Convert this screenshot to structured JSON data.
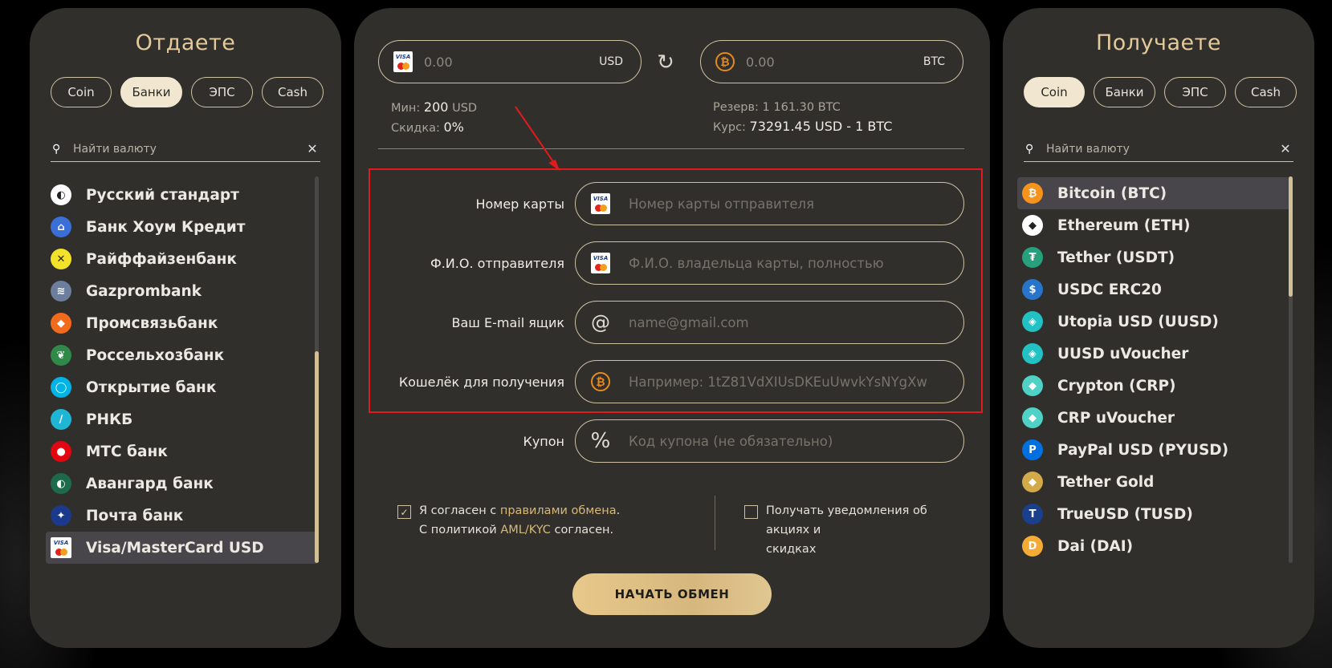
{
  "left": {
    "title": "Отдаете",
    "tabs": [
      "Coin",
      "Банки",
      "ЭПС",
      "Cash"
    ],
    "active_tab": "Банки",
    "search_placeholder": "Найти валюту",
    "items": [
      {
        "label": "Русский стандарт",
        "icon": "russkiy-standart-icon",
        "color": "#ffffff"
      },
      {
        "label": "Банк Хоум Кредит",
        "icon": "home-credit-icon",
        "color": "#3a6fd8"
      },
      {
        "label": "Райффайзенбанк",
        "icon": "raiffeisen-icon",
        "color": "#f4e22a"
      },
      {
        "label": "Gazprombank",
        "icon": "gazprombank-icon",
        "color": "#6d7d9c"
      },
      {
        "label": "Промсвязьбанк",
        "icon": "psb-icon",
        "color": "#f26b1d"
      },
      {
        "label": "Россельхозбанк",
        "icon": "rshb-icon",
        "color": "#2f8a4a"
      },
      {
        "label": "Открытие банк",
        "icon": "otkritie-icon",
        "color": "#00b4e6"
      },
      {
        "label": "РНКБ",
        "icon": "rnkb-icon",
        "color": "#1fb6d6"
      },
      {
        "label": "МТС банк",
        "icon": "mts-icon",
        "color": "#e30611"
      },
      {
        "label": "Авангард банк",
        "icon": "avangard-icon",
        "color": "#1d6b4a"
      },
      {
        "label": "Почта банк",
        "icon": "pochta-icon",
        "color": "#1b3a8c"
      },
      {
        "label": "Visa/MasterCard USD",
        "icon": "visa-mastercard-icon",
        "color": "#ffffff",
        "selected": true
      }
    ]
  },
  "right": {
    "title": "Получаете",
    "tabs": [
      "Coin",
      "Банки",
      "ЭПС",
      "Cash"
    ],
    "active_tab": "Coin",
    "search_placeholder": "Найти валюту",
    "items": [
      {
        "label": "Bitcoin (BTC)",
        "icon": "bitcoin-icon",
        "color": "#f7931a",
        "selected": true
      },
      {
        "label": "Ethereum (ETH)",
        "icon": "ethereum-icon",
        "color": "#ffffff"
      },
      {
        "label": "Tether (USDT)",
        "icon": "tether-icon",
        "color": "#26a17b"
      },
      {
        "label": "USDC ERC20",
        "icon": "usdc-icon",
        "color": "#2775ca"
      },
      {
        "label": "Utopia USD (UUSD)",
        "icon": "utopia-icon",
        "color": "#22c1c3"
      },
      {
        "label": "UUSD uVoucher",
        "icon": "uvoucher-icon",
        "color": "#22c1c3"
      },
      {
        "label": "Crypton (CRP)",
        "icon": "crypton-icon",
        "color": "#4fd1c5"
      },
      {
        "label": "CRP uVoucher",
        "icon": "crp-uvoucher-icon",
        "color": "#4fd1c5"
      },
      {
        "label": "PayPal USD (PYUSD)",
        "icon": "paypal-icon",
        "color": "#0070e0"
      },
      {
        "label": "Tether Gold",
        "icon": "tether-gold-icon",
        "color": "#d4a94a"
      },
      {
        "label": "TrueUSD (TUSD)",
        "icon": "trueusd-icon",
        "color": "#1a3f8c"
      },
      {
        "label": "Dai (DAI)",
        "icon": "dai-icon",
        "color": "#f5ac37"
      }
    ]
  },
  "exchange": {
    "give_value": "0.00",
    "give_currency": "USD",
    "get_value": "0.00",
    "get_currency": "BTC",
    "min_label": "Мин:",
    "min_value": "200",
    "min_unit": "USD",
    "discount_label": "Скидка:",
    "discount_value": "0%",
    "reserve": "Резерв: 1 161.30 BTC",
    "rate_label": "Курс:",
    "rate_value": "73291.45 USD - 1 BTC"
  },
  "form": {
    "card_label": "Номер карты",
    "card_placeholder": "Номер карты отправителя",
    "name_label": "Ф.И.О. отправителя",
    "name_placeholder": "Ф.И.О. владельца карты, полностью",
    "email_label": "Ваш E-mail ящик",
    "email_placeholder": "name@gmail.com",
    "wallet_label": "Кошелёк для получения",
    "wallet_placeholder": "Например: 1tZ81VdXIUsDKEuUwvkYsNYgXw",
    "coupon_label": "Купон",
    "coupon_placeholder": "Код купона (не обязательно)"
  },
  "agreement": {
    "text_1": "Я согласен с",
    "rules_link": "правилами обмена",
    "text_2": ".",
    "text_3": "С политикой",
    "aml_link": "AML/KYC",
    "text_4": "согласен.",
    "checked": true
  },
  "notify": {
    "text_line1": "Получать уведомления об акциях и",
    "text_line2": "скидках",
    "checked": false
  },
  "submit_label": "НАЧАТЬ ОБМЕН",
  "accent_color": "#e4c99b",
  "highlight_color": "#e01b1b"
}
